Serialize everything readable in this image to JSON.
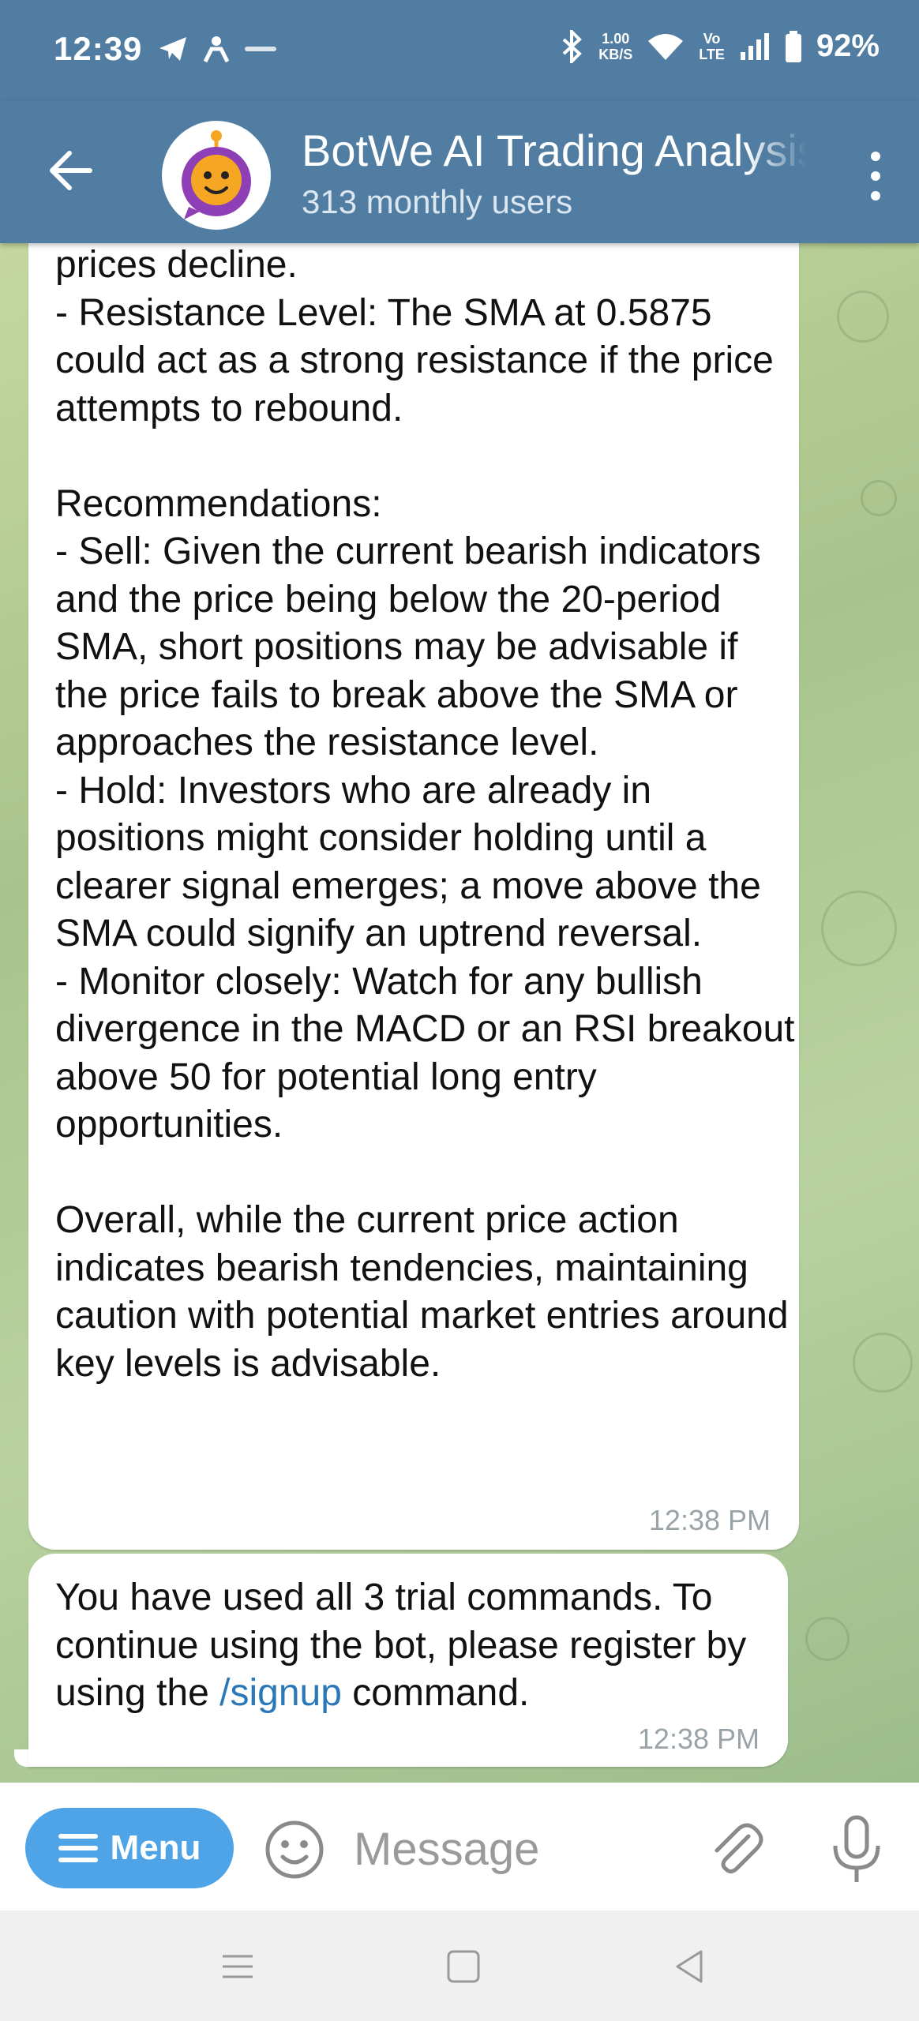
{
  "status_bar": {
    "time": "12:39",
    "net_speed_value": "1.00",
    "net_speed_unit": "KB/S",
    "lte_top": "Vo",
    "lte_bottom": "LTE",
    "battery": "92%",
    "left_icons": [
      "telegram-icon",
      "person-icon",
      "zomato-icon"
    ],
    "right_icons": [
      "bluetooth-icon",
      "wifi-icon",
      "signal-icon",
      "battery-icon"
    ]
  },
  "header": {
    "title": "BotWe AI Trading Analysis",
    "subtitle": "313 monthly users"
  },
  "messages": [
    {
      "text": "prices decline.\n- Resistance Level: The SMA at 0.5875 could act as a strong resistance if the price attempts to rebound.\n\nRecommendations:\n- Sell: Given the current bearish indicators and the price being below the 20-period SMA, short positions may be advisable if the price fails to break above the SMA or approaches the resistance level.\n- Hold: Investors who are already in positions might consider holding until a clearer signal emerges; a move above the SMA could signify an uptrend reversal.\n- Monitor closely: Watch for any bullish divergence in the MACD or an RSI breakout above 50 for potential long entry opportunities.\n\nOverall, while the current price action indicates bearish tendencies, maintaining caution with potential market entries around key levels is advisable.",
      "time": "12:38 PM"
    },
    {
      "text_before": "You have used all 3 trial commands. To continue using the bot, please register by using the ",
      "link": "/signup",
      "text_after": " command.",
      "time": "12:38 PM"
    }
  ],
  "input_bar": {
    "menu_label": "Menu",
    "placeholder": "Message"
  },
  "colors": {
    "header": "#517da2",
    "menu_button": "#4ea4e6",
    "link": "#2a78b8"
  }
}
